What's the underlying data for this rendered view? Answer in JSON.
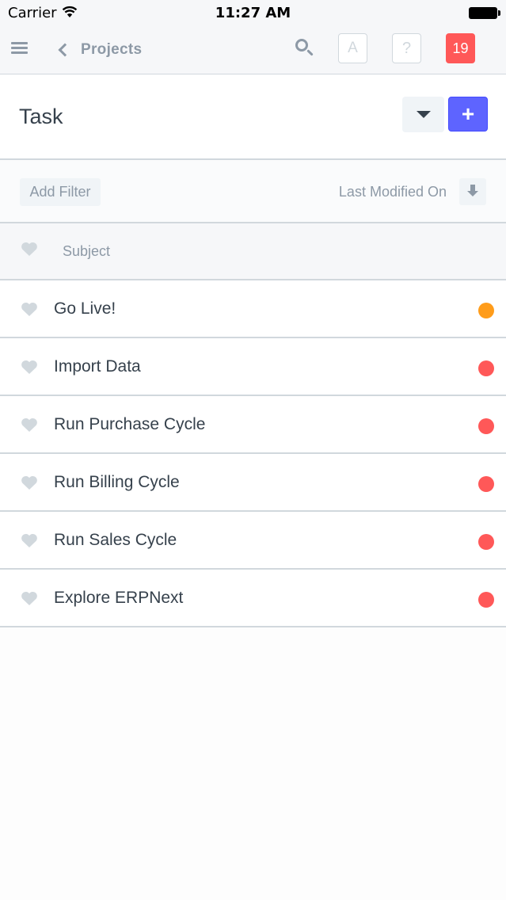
{
  "status_bar": {
    "carrier": "Carrier",
    "time": "11:27 AM"
  },
  "navbar": {
    "back_label": "Projects",
    "avatar_letter": "A",
    "help_label": "?",
    "notification_count": "19"
  },
  "page": {
    "title": "Task"
  },
  "filter_bar": {
    "add_filter_label": "Add Filter",
    "sort_label": "Last Modified On"
  },
  "list": {
    "header_label": "Subject",
    "rows": [
      {
        "subject": "Go Live!",
        "indicator_color": "#ff9c1a"
      },
      {
        "subject": "Import Data",
        "indicator_color": "#ff5858"
      },
      {
        "subject": "Run Purchase Cycle",
        "indicator_color": "#ff5858"
      },
      {
        "subject": "Run Billing Cycle",
        "indicator_color": "#ff5858"
      },
      {
        "subject": "Run Sales Cycle",
        "indicator_color": "#ff5858"
      },
      {
        "subject": "Explore ERPNext",
        "indicator_color": "#ff5858"
      }
    ]
  },
  "colors": {
    "primary": "#5e64ff",
    "notification": "#ff5858",
    "indicator_orange": "#ff9c1a",
    "indicator_red": "#ff5858",
    "muted_text": "#8d99a6"
  }
}
